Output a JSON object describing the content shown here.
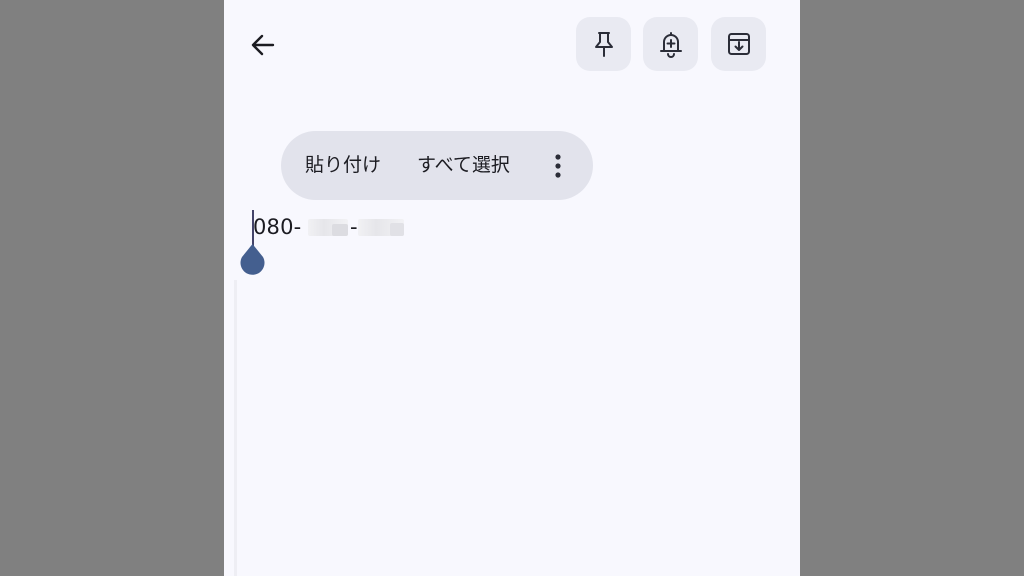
{
  "toolbar": {
    "back_icon": "arrow-left-icon",
    "actions": [
      {
        "name": "pin",
        "icon": "pin-icon"
      },
      {
        "name": "reminder",
        "icon": "bell-plus-icon"
      },
      {
        "name": "archive",
        "icon": "archive-icon"
      }
    ]
  },
  "context_menu": {
    "paste_label": "貼り付け",
    "select_all_label": "すべて選択",
    "more_icon": "more-vert-icon"
  },
  "note": {
    "text_prefix": "080-",
    "text_separator": "-"
  },
  "colors": {
    "background": "#f8f8fe",
    "button_bg": "#e9eaf2",
    "menu_bg": "#e2e3ec",
    "handle": "#445f8f",
    "outside": "#808080"
  }
}
